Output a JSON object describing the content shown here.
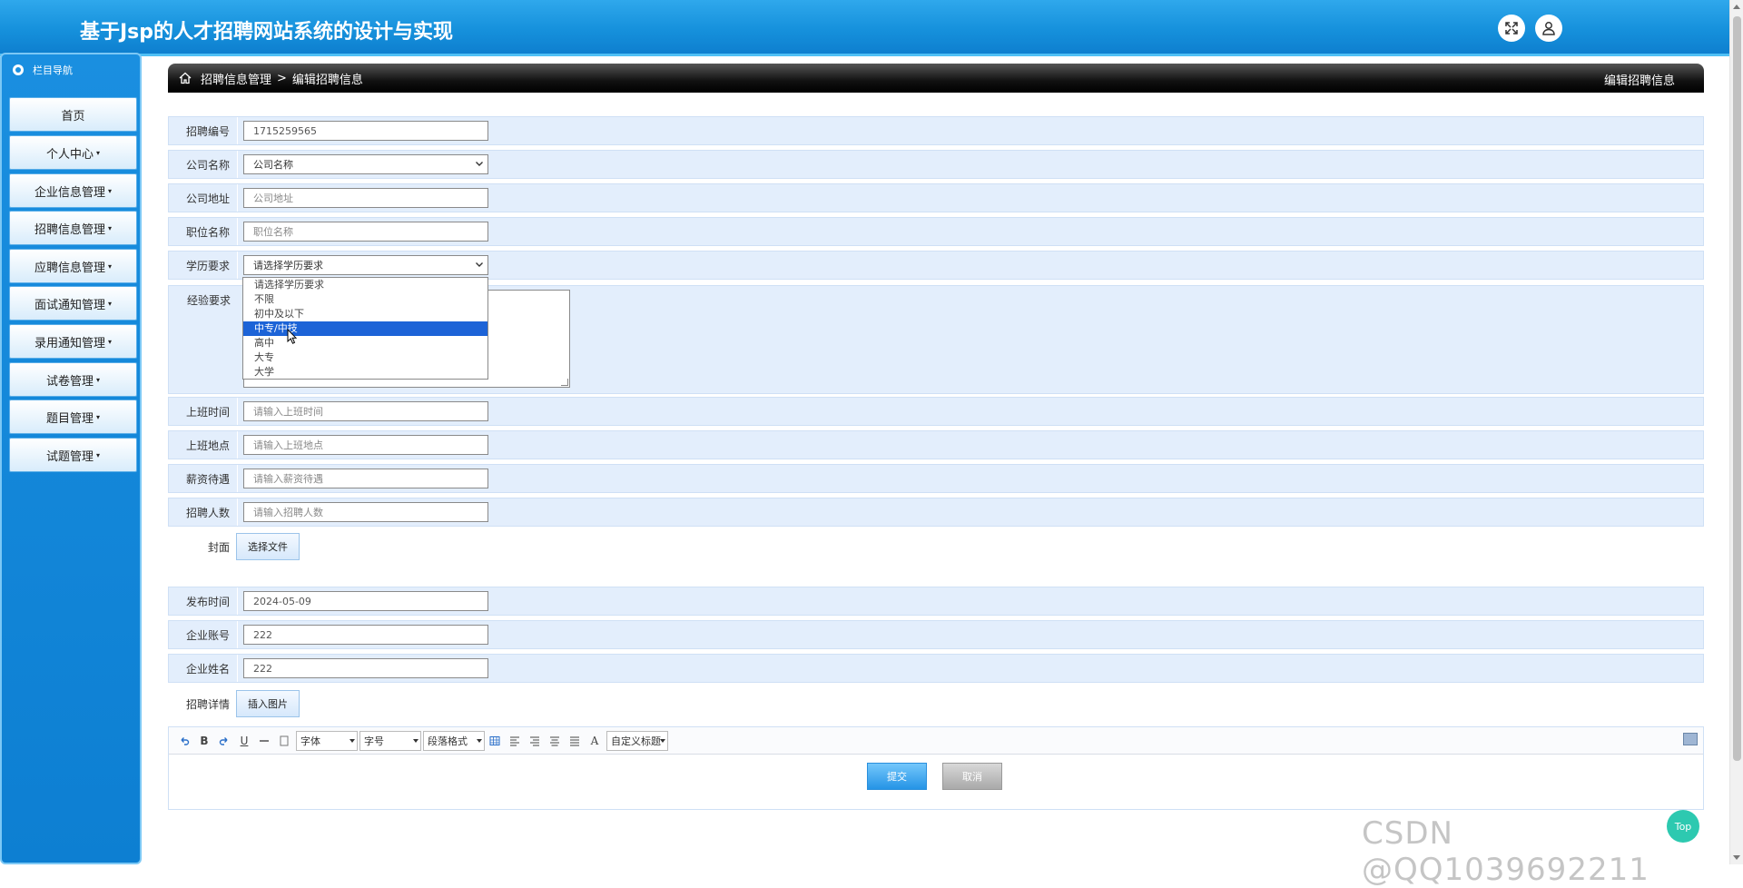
{
  "header": {
    "title": "基于Jsp的人才招聘网站系统的设计与实现"
  },
  "sidebar": {
    "head": "栏目导航",
    "items": [
      {
        "label": "首页",
        "caret": ""
      },
      {
        "label": "个人中心",
        "caret": "▾"
      },
      {
        "label": "企业信息管理",
        "caret": "▾"
      },
      {
        "label": "招聘信息管理",
        "caret": "▾"
      },
      {
        "label": "应聘信息管理",
        "caret": "▾"
      },
      {
        "label": "面试通知管理",
        "caret": "▾"
      },
      {
        "label": "录用通知管理",
        "caret": "▾"
      },
      {
        "label": "试卷管理",
        "caret": "▾"
      },
      {
        "label": "题目管理",
        "caret": "▾"
      },
      {
        "label": "试题管理",
        "caret": "▾"
      }
    ]
  },
  "breadcrumb": {
    "section": "招聘信息管理",
    "separator": ">",
    "page": "编辑招聘信息",
    "right_title": "编辑招聘信息"
  },
  "form": {
    "recruit_no": {
      "label": "招聘编号",
      "value": "1715259565"
    },
    "company_name": {
      "label": "公司名称",
      "value": "公司名称"
    },
    "company_addr": {
      "label": "公司地址",
      "placeholder": "公司地址"
    },
    "position": {
      "label": "职位名称",
      "placeholder": "职位名称"
    },
    "education": {
      "label": "学历要求",
      "value": "请选择学历要求"
    },
    "experience": {
      "label": "经验要求"
    },
    "work_time": {
      "label": "上班时间",
      "placeholder": "请输入上班时间"
    },
    "work_place": {
      "label": "上班地点",
      "placeholder": "请输入上班地点"
    },
    "salary": {
      "label": "薪资待遇",
      "placeholder": "请输入薪资待遇"
    },
    "headcount": {
      "label": "招聘人数",
      "placeholder": "请输入招聘人数"
    },
    "cover": {
      "label": "封面",
      "button": "选择文件"
    },
    "publish_time": {
      "label": "发布时间",
      "value": "2024-05-09"
    },
    "company_account": {
      "label": "企业账号",
      "value": "222"
    },
    "company_person": {
      "label": "企业姓名",
      "value": "222"
    },
    "details": {
      "label": "招聘详情",
      "button": "插入图片"
    }
  },
  "dropdown": {
    "options": [
      "请选择学历要求",
      "不限",
      "初中及以下",
      "中专/中技",
      "高中",
      "大专",
      "大学"
    ],
    "selected_index": 3
  },
  "editor": {
    "font": "字体",
    "size": "字号",
    "paragraph": "段落格式",
    "custom_title": "自定义标题",
    "bold": "B",
    "underline": "U",
    "letter_a": "A"
  },
  "actions": {
    "submit": "提交",
    "cancel": "取消"
  },
  "watermark": "CSDN @QQ1039692211",
  "top_badge": "Top"
}
